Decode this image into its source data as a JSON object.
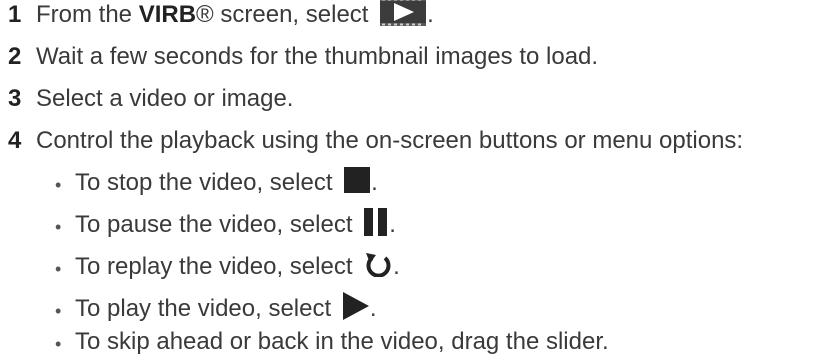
{
  "steps": [
    {
      "number": "1",
      "pre": "From the ",
      "bold": "VIRB",
      "post": "® screen, select ",
      "icon": "video-play-tile-icon",
      "end": "."
    },
    {
      "number": "2",
      "text": "Wait a few seconds for the thumbnail images to load."
    },
    {
      "number": "3",
      "text": "Select a video or image."
    },
    {
      "number": "4",
      "text": "Control the playback using the on-screen buttons or menu options:"
    }
  ],
  "sub_items": [
    {
      "text": "To stop the video, select ",
      "icon": "stop-icon",
      "end": "."
    },
    {
      "text": "To pause the video, select ",
      "icon": "pause-icon",
      "end": "."
    },
    {
      "text": "To replay the video, select ",
      "icon": "replay-icon",
      "end": "."
    },
    {
      "text": "To play the video, select ",
      "icon": "play-icon",
      "end": "."
    },
    {
      "text": "To skip ahead or back in the video, drag the slider."
    }
  ],
  "bullet_char": "•",
  "colors": {
    "text": "#3a3a3a",
    "icon_dark": "#222222",
    "tile_bg": "#3c3c3c"
  }
}
